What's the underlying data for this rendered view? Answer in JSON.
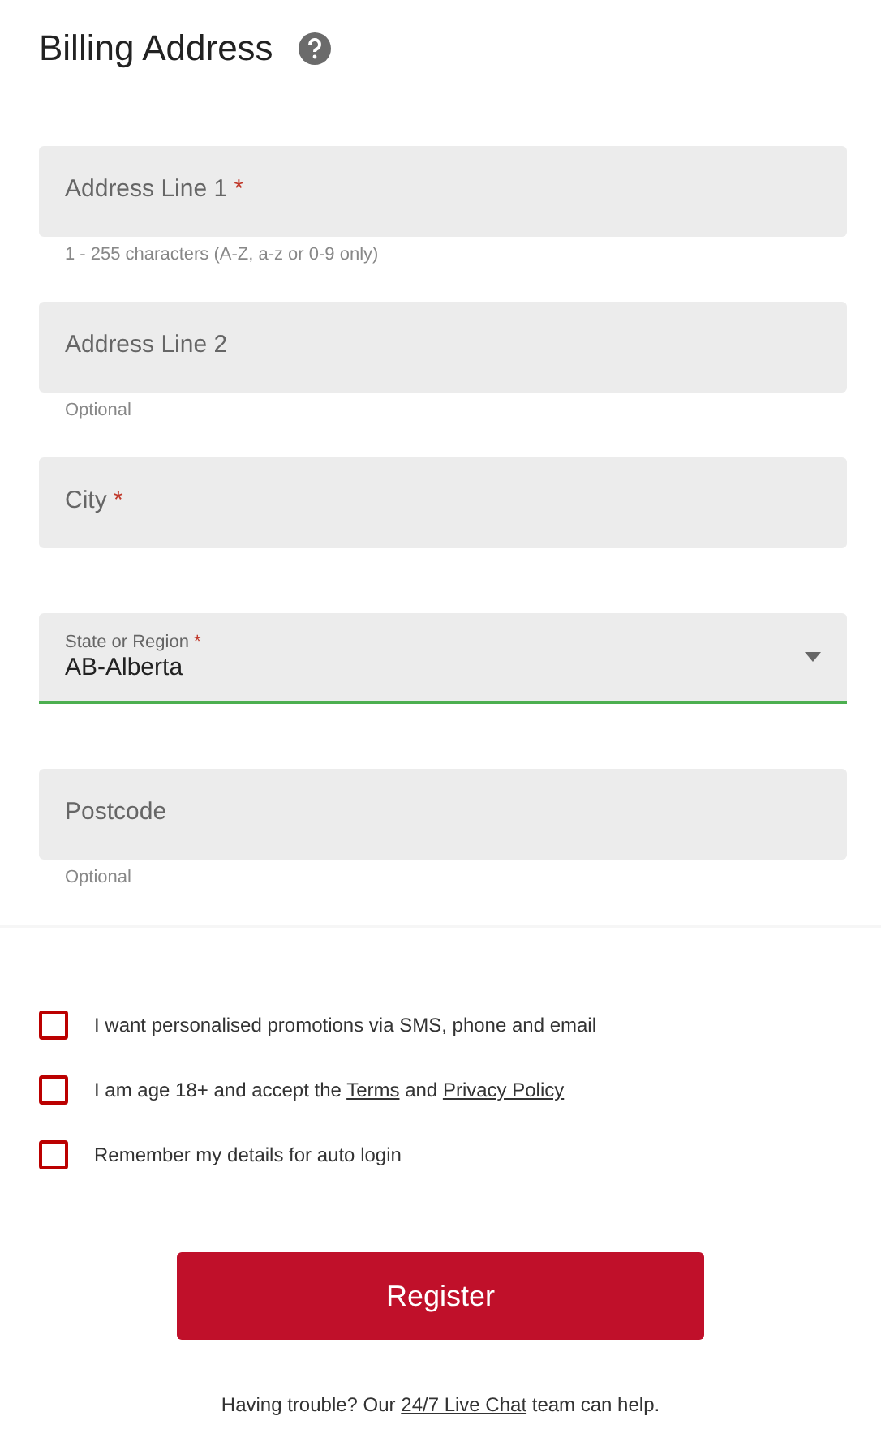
{
  "title": "Billing Address",
  "fields": [
    {
      "kind": "text",
      "placeholder": "Address Line 1",
      "required_mark": "*",
      "help": "1 - 255 characters (A-Z, a-z or 0-9 only)"
    },
    {
      "kind": "text",
      "placeholder": "Address Line 2",
      "help": "Optional"
    },
    {
      "kind": "text",
      "placeholder": "City",
      "required_mark": "*"
    },
    {
      "kind": "select",
      "label": "State or Region",
      "required_mark": "*",
      "value": "AB-Alberta",
      "valid": true
    },
    {
      "kind": "text",
      "placeholder": "Postcode",
      "help": "Optional"
    }
  ],
  "checkboxes": [
    {
      "checked": false,
      "segments": [
        {
          "kind": "text",
          "text": "I want personalised promotions via SMS, phone and email"
        }
      ]
    },
    {
      "checked": false,
      "segments": [
        {
          "kind": "text",
          "text": "I am age 18+ and accept the "
        },
        {
          "kind": "link",
          "text": "Terms"
        },
        {
          "kind": "text",
          "text": " and "
        },
        {
          "kind": "link",
          "text": "Privacy Policy"
        }
      ]
    },
    {
      "checked": false,
      "segments": [
        {
          "kind": "text",
          "text": "Remember my details for auto login"
        }
      ]
    }
  ],
  "button": "Register",
  "footer": [
    {
      "kind": "text",
      "text": "Having trouble? Our "
    },
    {
      "kind": "link",
      "text": "24/7 Live Chat"
    },
    {
      "kind": "text",
      "text": " team can help."
    }
  ]
}
